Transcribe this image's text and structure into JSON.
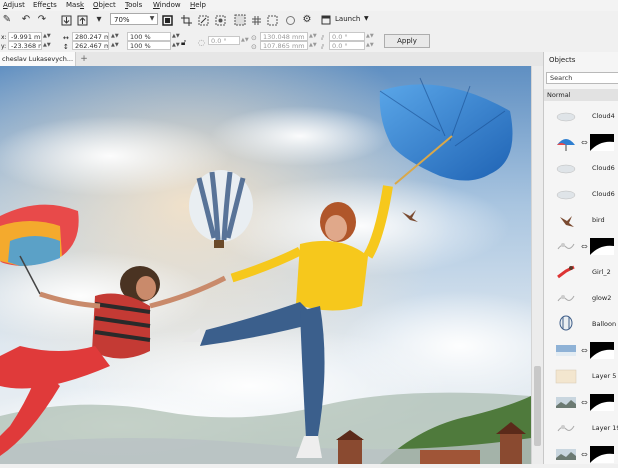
{
  "menu": [
    {
      "name": "adjust",
      "pre": "",
      "u": "A",
      "post": "djust"
    },
    {
      "name": "effects",
      "pre": "Effe",
      "u": "c",
      "post": "ts"
    },
    {
      "name": "mask",
      "pre": "Mas",
      "u": "k",
      "post": ""
    },
    {
      "name": "object",
      "pre": "",
      "u": "O",
      "post": "bject"
    },
    {
      "name": "tools",
      "pre": "",
      "u": "T",
      "post": "ools"
    },
    {
      "name": "window",
      "pre": "",
      "u": "W",
      "post": "indow"
    },
    {
      "name": "help",
      "pre": "",
      "u": "H",
      "post": "elp"
    }
  ],
  "toolbar": {
    "zoom": "70%",
    "launch_label": "Launch"
  },
  "properties": {
    "x": "-9.991 mm",
    "y": "-23.368 mm",
    "width": "280.247 mm",
    "height": "262.467 mm",
    "scale_x": "100 %",
    "scale_y": "100 %",
    "angle": "0.0 °",
    "center_x": "130.048 mm",
    "center_y": "107.865 mm",
    "skew_x": "0.0 °",
    "skew_y": "0.0 °",
    "apply_label": "Apply"
  },
  "document": {
    "tab_title": "cheslav Lukasevych...",
    "add_tab": "+"
  },
  "objects_panel": {
    "title": "Objects",
    "search_placeholder": "Search",
    "blend_mode": "Normal",
    "items": [
      {
        "name": "Cloud4",
        "thumb": "cloud",
        "mask": false
      },
      {
        "name": "",
        "thumb": "umbrella",
        "mask": true
      },
      {
        "name": "Cloud6",
        "thumb": "cloud",
        "mask": false
      },
      {
        "name": "Cloud6",
        "thumb": "cloud",
        "mask": false
      },
      {
        "name": "bird",
        "thumb": "bird",
        "mask": false
      },
      {
        "name": "",
        "thumb": "sketch",
        "mask": true
      },
      {
        "name": "Girl_2",
        "thumb": "girl",
        "mask": false
      },
      {
        "name": "glow2",
        "thumb": "sketch",
        "mask": false
      },
      {
        "name": "Balloon",
        "thumb": "balloon",
        "mask": false
      },
      {
        "name": "",
        "thumb": "sky",
        "mask": true
      },
      {
        "name": "Layer 5",
        "thumb": "paper",
        "mask": false
      },
      {
        "name": "",
        "thumb": "landscape",
        "mask": true
      },
      {
        "name": "Layer 19",
        "thumb": "sketch",
        "mask": false
      },
      {
        "name": "",
        "thumb": "landscape",
        "mask": true
      }
    ]
  },
  "colors": {
    "sky_top": "#5f8fc2",
    "sky_mid": "#b9d0e6",
    "umbrella_blue": "#2f7fd0",
    "sweater_yellow": "#f6c81c",
    "jeans_blue": "#3b5f8c",
    "pants_red": "#e03a3a",
    "panel_bg": "#f5f5f5"
  }
}
